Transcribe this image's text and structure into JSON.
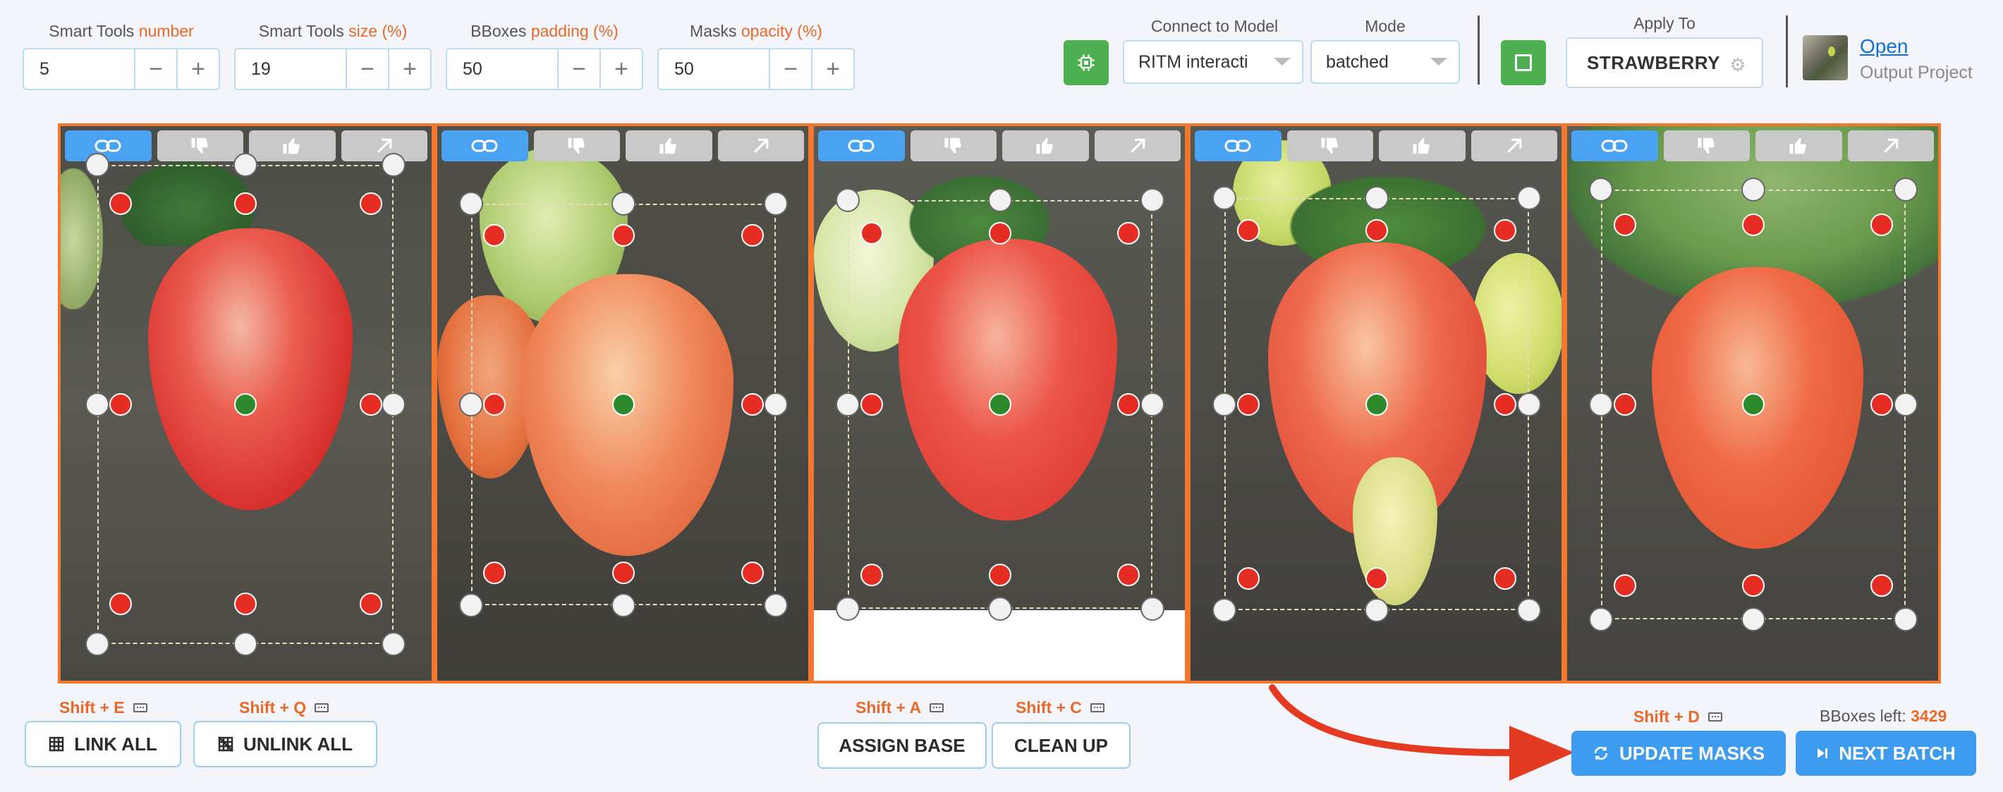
{
  "controls": [
    {
      "label_prefix": "Smart Tools ",
      "label_accent": "number",
      "value": "5"
    },
    {
      "label_prefix": "Smart Tools ",
      "label_accent": "size (%)",
      "value": "19"
    },
    {
      "label_prefix": "BBoxes ",
      "label_accent": "padding (%)",
      "value": "50"
    },
    {
      "label_prefix": "Masks ",
      "label_accent": "opacity (%)",
      "value": "50"
    }
  ],
  "model": {
    "label": "Connect to Model",
    "value": "RITM interacti"
  },
  "mode": {
    "label": "Mode",
    "value": "batched"
  },
  "apply_to": {
    "label": "Apply To",
    "value": "STRAWBERRY"
  },
  "output": {
    "open_link": "Open",
    "label": "Output Project"
  },
  "icons": {
    "cpu": "cpu-icon",
    "select": "checkbox-square-icon",
    "settings": "gear-icon",
    "link": "link-icon",
    "dislike": "thumbs-down-icon",
    "like": "thumbs-up-icon",
    "expand": "arrow-up-right-icon",
    "grid": "grid-icon",
    "unlink-grid": "unlink-grid-icon",
    "refresh": "refresh-icon",
    "next": "skip-next-icon",
    "keyboard": "keyboard-icon"
  },
  "actions": {
    "link_all": {
      "label": "LINK ALL",
      "shortcut": "Shift + E"
    },
    "unlink_all": {
      "label": "UNLINK ALL",
      "shortcut": "Shift + Q"
    },
    "assign_base": {
      "label": "ASSIGN BASE",
      "shortcut": "Shift + A"
    },
    "clean_up": {
      "label": "CLEAN UP",
      "shortcut": "Shift + C"
    },
    "update_masks": {
      "label": "UPDATE MASKS",
      "shortcut": "Shift + D"
    },
    "next_batch": {
      "label": "NEXT BATCH"
    }
  },
  "bboxes_left": {
    "label": "BBoxes left: ",
    "value": "3429"
  },
  "colors": {
    "accent": "#e8692a",
    "primary": "#3d9cef",
    "success": "#4caf50",
    "point_positive": "#2c8a2c",
    "point_negative": "#e52d24",
    "frame": "#f2782f"
  }
}
